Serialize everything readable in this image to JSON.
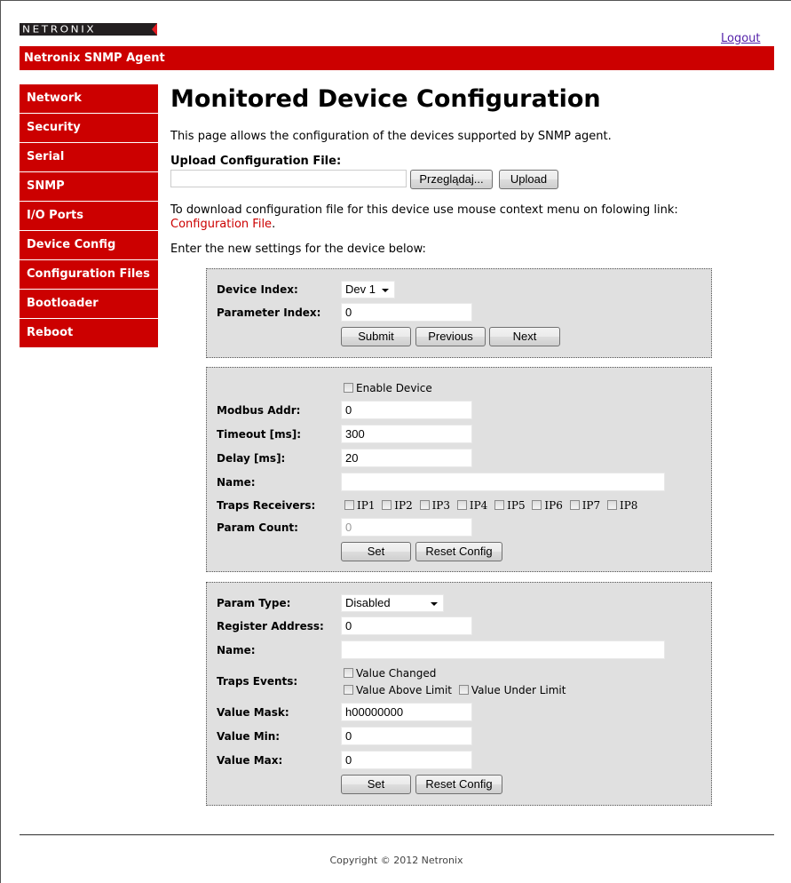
{
  "logo": {
    "text": "NETRONIX"
  },
  "header": {
    "logout": "Logout",
    "banner": "Netronix SNMP Agent"
  },
  "sidebar": {
    "items": [
      {
        "label": "Network"
      },
      {
        "label": "Security"
      },
      {
        "label": "Serial"
      },
      {
        "label": "SNMP"
      },
      {
        "label": "I/O Ports"
      },
      {
        "label": "Device Config"
      },
      {
        "label": "Configuration Files"
      },
      {
        "label": "Bootloader"
      },
      {
        "label": "Reboot"
      }
    ]
  },
  "main": {
    "title": "Monitored Device Configuration",
    "intro": "This page allows the configuration of the devices supported by SNMP agent.",
    "upload_label": "Upload Configuration File:",
    "browse_button": "Przeglądaj...",
    "upload_button": "Upload",
    "download_text": "To download configuration file for this device use mouse context menu on folowing link:",
    "download_link": "Configuration File",
    "download_period": ".",
    "enter_text": "Enter the new settings for the device below:"
  },
  "panel1": {
    "device_index_label": "Device Index:",
    "device_index_value": "Dev 1",
    "parameter_index_label": "Parameter Index:",
    "parameter_index_value": "0",
    "submit": "Submit",
    "previous": "Previous",
    "next": "Next"
  },
  "panel2": {
    "enable_device": "Enable Device",
    "modbus_label": "Modbus Addr:",
    "modbus_value": "0",
    "timeout_label": "Timeout [ms]:",
    "timeout_value": "300",
    "delay_label": "Delay [ms]:",
    "delay_value": "20",
    "name_label": "Name:",
    "name_value": "",
    "traps_label": "Traps Receivers:",
    "traps": [
      "IP1",
      "IP2",
      "IP3",
      "IP4",
      "IP5",
      "IP6",
      "IP7",
      "IP8"
    ],
    "param_count_label": "Param Count:",
    "param_count_value": "0",
    "set": "Set",
    "reset": "Reset Config"
  },
  "panel3": {
    "param_type_label": "Param Type:",
    "param_type_value": "Disabled",
    "register_label": "Register Address:",
    "register_value": "0",
    "name_label": "Name:",
    "name_value": "",
    "traps_events_label": "Traps Events:",
    "value_changed": "Value Changed",
    "value_above": "Value Above Limit",
    "value_under": "Value Under Limit",
    "mask_label": "Value Mask:",
    "mask_value": "h00000000",
    "min_label": "Value Min:",
    "min_value": "0",
    "max_label": "Value Max:",
    "max_value": "0",
    "set": "Set",
    "reset": "Reset Config"
  },
  "footer": {
    "copyright": "Copyright © 2012 Netronix"
  }
}
